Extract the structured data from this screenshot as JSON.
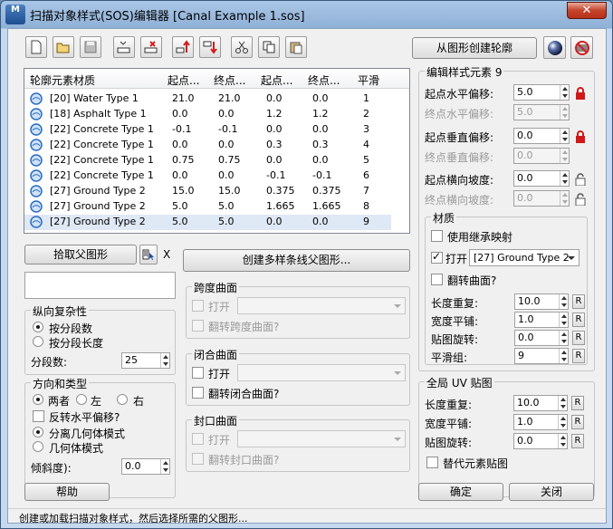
{
  "window": {
    "title": "扫描对象样式(SOS)编辑器 [Canal Example 1.sos]",
    "icon_text": "M"
  },
  "toolbar": {
    "create_from_shape": "从图形创建轮廓"
  },
  "list": {
    "headers": [
      "轮廓元素材质",
      "起点...",
      "终点...",
      "起点...",
      "终点...",
      "平滑"
    ],
    "rows": [
      [
        "[20] Water Type 1",
        "21.0",
        "21.0",
        "0.0",
        "0.0",
        "1"
      ],
      [
        "[18] Asphalt Type 1",
        "0.0",
        "0.0",
        "1.2",
        "1.2",
        "2"
      ],
      [
        "[22] Concrete Type 1",
        "-0.1",
        "-0.1",
        "0.0",
        "0.0",
        "3"
      ],
      [
        "[22] Concrete Type 1",
        "0.0",
        "0.0",
        "0.3",
        "0.3",
        "4"
      ],
      [
        "[22] Concrete Type 1",
        "0.75",
        "0.75",
        "0.0",
        "0.0",
        "5"
      ],
      [
        "[22] Concrete Type 1",
        "0.0",
        "0.0",
        "-0.1",
        "-0.1",
        "6"
      ],
      [
        "[27] Ground Type 2",
        "15.0",
        "15.0",
        "0.375",
        "0.375",
        "7"
      ],
      [
        "[27] Ground Type 2",
        "5.0",
        "5.0",
        "1.665",
        "1.665",
        "8"
      ],
      [
        "[27] Ground Type 2",
        "5.0",
        "5.0",
        "0.0",
        "0.0",
        "9"
      ]
    ]
  },
  "pick": {
    "pick_parent": "拾取父图形",
    "x_label": "X"
  },
  "create_multi": "创建多样条线父图形...",
  "complexity": {
    "title": "纵向复杂性",
    "by_segments": "按分段数",
    "by_length": "按分段长度",
    "segments_label": "分段数:",
    "segments_value": "25"
  },
  "direction": {
    "title": "方向和类型",
    "both": "两者",
    "left": "左",
    "right": "右",
    "flip_h": "反转水平偏移?",
    "split_mode": "分离几何体模式",
    "geom_mode": "几何体模式",
    "slope_label": "倾斜度):",
    "slope_value": "0.0"
  },
  "span": {
    "title": "跨度曲面",
    "open": "打开",
    "flip": "翻转跨度曲面?"
  },
  "closed": {
    "title": "闭合曲面",
    "open": "打开",
    "flip": "翻转闭合曲面?"
  },
  "cap": {
    "title": "封口曲面",
    "open": "打开",
    "flip": "翻转封口曲面?"
  },
  "edit": {
    "title": "编辑样式元素 9",
    "start_h": "起点水平偏移:",
    "start_h_val": "5.0",
    "end_h": "终点水平偏移:",
    "end_h_val": "5.0",
    "start_v": "起点垂直偏移:",
    "start_v_val": "0.0",
    "end_v": "终点垂直偏移:",
    "end_v_val": "0.0",
    "start_s": "起点横向坡度:",
    "start_s_val": "0.0",
    "end_s": "终点横向坡度:",
    "end_s_val": "0.0"
  },
  "material": {
    "title": "材质",
    "inherit": "使用继承映射",
    "open": "打开",
    "material_value": "[27] Ground Type 2",
    "flip": "翻转曲面?",
    "len_rep": "长度重复:",
    "len_rep_val": "10.0",
    "width_tile": "宽度平铺:",
    "width_tile_val": "1.0",
    "map_rot": "贴图旋转:",
    "map_rot_val": "0.0",
    "smooth": "平滑组:",
    "smooth_val": "9",
    "r_label": "R"
  },
  "global_uv": {
    "title": "全局 UV 贴图",
    "len_rep": "长度重复:",
    "len_rep_val": "10.0",
    "width_tile": "宽度平铺:",
    "width_tile_val": "1.0",
    "map_rot": "贴图旋转:",
    "map_rot_val": "0.0",
    "override": "替代元素贴图",
    "r_label": "R"
  },
  "buttons": {
    "help": "帮助",
    "ok": "确定",
    "close": "关闭"
  },
  "status": "创建或加载扫描对象样式，然后选择所需的父图形..."
}
